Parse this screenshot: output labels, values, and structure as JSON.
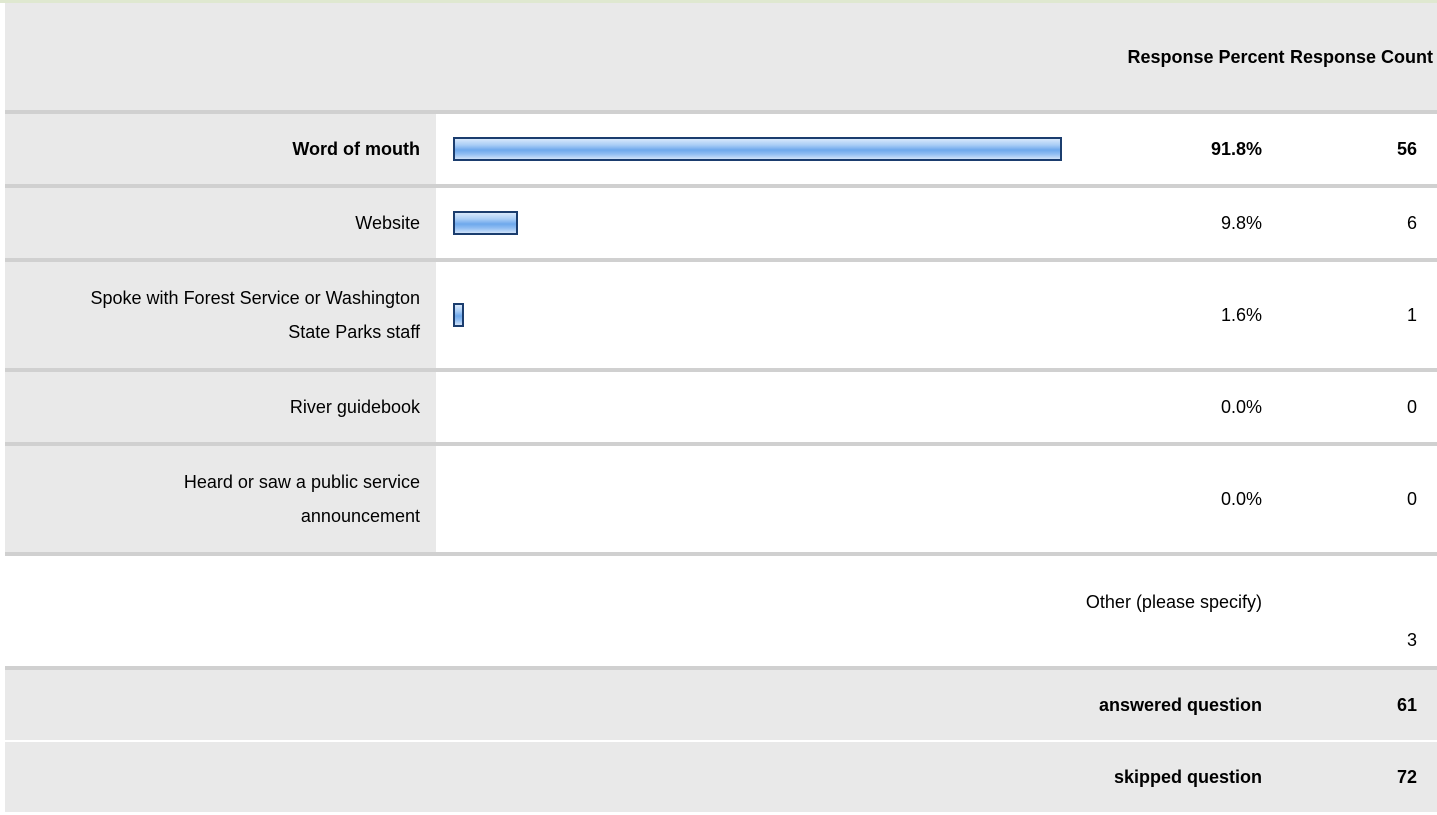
{
  "header": {
    "percent_label": "Response Percent",
    "count_label": "Response Count"
  },
  "chart_data": {
    "type": "bar",
    "orientation": "horizontal",
    "categories": [
      "Word of mouth",
      "Website",
      "Spoke with Forest Service or Washington State Parks staff",
      "River guidebook",
      "Heard or saw a public service announcement"
    ],
    "values": [
      91.8,
      9.8,
      1.6,
      0.0,
      0.0
    ],
    "percent_labels": [
      "91.8%",
      "9.8%",
      "1.6%",
      "0.0%",
      "0.0%"
    ],
    "counts": [
      "56",
      "6",
      "1",
      "0",
      "0"
    ],
    "xlim": [
      0,
      100
    ],
    "colors": {
      "bar_fill": "#6ea8ec",
      "bar_border": "#1b3d6e"
    }
  },
  "other": {
    "label": "Other (please specify)",
    "count": "3"
  },
  "summary": {
    "answered_label": "answered question",
    "answered_count": "61",
    "skipped_label": "skipped question",
    "skipped_count": "72"
  }
}
